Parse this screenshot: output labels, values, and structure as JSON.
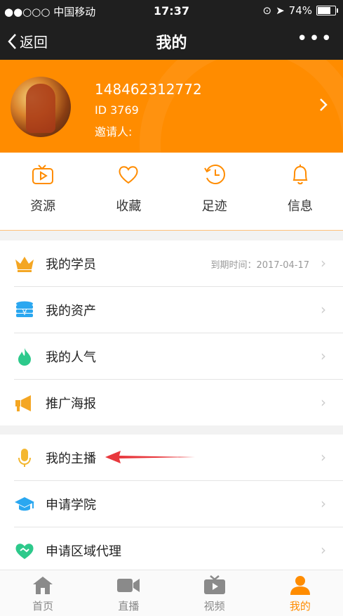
{
  "status_bar": {
    "carrier": "●●○○○ 中国移动",
    "time": "17:37",
    "battery": "74%"
  },
  "nav": {
    "back_label": "返回",
    "title": "我的",
    "more_label": "•••"
  },
  "profile": {
    "phone": "148462312772",
    "id_line": "ID 3769",
    "inviter_line": "邀请人:"
  },
  "quick_actions": [
    {
      "label": "资源",
      "icon": "play-tv-icon"
    },
    {
      "label": "收藏",
      "icon": "heart-icon"
    },
    {
      "label": "足迹",
      "icon": "history-clock-icon"
    },
    {
      "label": "信息",
      "icon": "bell-icon"
    }
  ],
  "menu_group1": [
    {
      "label": "我的学员",
      "meta": "到期时间：2017-04-17",
      "icon": "crown-icon"
    },
    {
      "label": "我的资产",
      "icon": "coin-stack-icon"
    },
    {
      "label": "我的人气",
      "icon": "flame-icon"
    },
    {
      "label": "推广海报",
      "icon": "megaphone-icon"
    }
  ],
  "menu_group2": [
    {
      "label": "我的主播",
      "icon": "microphone-icon"
    },
    {
      "label": "申请学院",
      "icon": "graduation-cap-icon"
    },
    {
      "label": "申请区域代理",
      "icon": "handshake-heart-icon"
    }
  ],
  "tabs": [
    {
      "label": "首页",
      "icon": "home-icon"
    },
    {
      "label": "直播",
      "icon": "video-camera-icon"
    },
    {
      "label": "视频",
      "icon": "tv-icon"
    },
    {
      "label": "我的",
      "icon": "user-icon",
      "active": true
    }
  ],
  "colors": {
    "accent": "#ff8c00",
    "dark_bar": "#1f1f1f",
    "arrow_annotation": "#e8383d"
  }
}
